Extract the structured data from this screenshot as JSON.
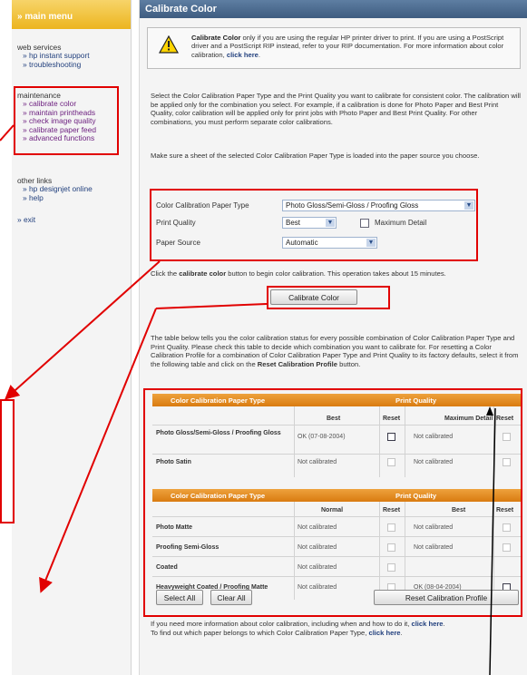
{
  "sidebar": {
    "header": "» main menu",
    "web_services": {
      "title": "web services",
      "links": [
        "» hp instant support",
        "» troubleshooting"
      ]
    },
    "maintenance": {
      "title": "maintenance",
      "links": [
        "» calibrate color",
        "» maintain printheads",
        "» check image quality",
        "» calibrate paper feed",
        "» advanced functions"
      ]
    },
    "other_links": {
      "title": "other links",
      "links": [
        "» hp designjet online",
        "» help"
      ]
    },
    "exit": "» exit"
  },
  "main": {
    "title": "Calibrate Color",
    "notice": {
      "bold_lead": "Calibrate Color",
      "text": " only if you are using the regular HP printer driver to print. If you are using a PostScript driver and a PostScript RIP instead, refer to your RIP documentation. For more information about color calibration, ",
      "link": "click here",
      "end": "."
    },
    "para1": "Select the Color Calibration Paper Type and the Print Quality you want to calibrate for consistent color. The calibration will be applied only for the combination you select. For example, if a calibration is done for Photo Paper and Best Print Quality, color calibration will be applied only for print jobs with Photo Paper and Best Print Quality. For other combinations, you must perform separate color calibrations.",
    "para2": "Make sure a sheet of the selected Color Calibration Paper Type is loaded into the paper source you choose.",
    "form": {
      "paper_type_label": "Color Calibration Paper Type",
      "paper_type_value": "Photo Gloss/Semi-Gloss / Proofing Gloss",
      "quality_label": "Print Quality",
      "quality_value": "Best",
      "max_detail_label": "Maximum Detail",
      "source_label": "Paper Source",
      "source_value": "Automatic"
    },
    "para3_a": "Click the ",
    "para3_b": "calibrate color",
    "para3_c": " button to begin color calibration. This operation takes about 15 minutes.",
    "calibrate_button": "Calibrate Color",
    "para4_a": "The table below tells you the color calibration status for every possible combination of Color Calibration Paper Type and Print Quality. Please check this table to decide which combination you want to calibrate for. For resetting a Color Calibration Profile for a combination of Color Calibration Paper Type and Print Quality to its factory defaults, select it from the following table and click on the ",
    "para4_b": "Reset Calibration Profile",
    "para4_c": " button.",
    "table1": {
      "col_paper": "Color Calibration Paper Type",
      "col_quality": "Print Quality",
      "sub": [
        "Best",
        "Reset",
        "Maximum Detail",
        "Reset"
      ],
      "rows": [
        {
          "paper": "Photo Gloss/Semi-Gloss / Proofing Gloss",
          "v1": "OK (07-08-2004)",
          "v2": "Not calibrated"
        },
        {
          "paper": "Photo Satin",
          "v1": "Not calibrated",
          "v2": "Not calibrated"
        }
      ]
    },
    "table2": {
      "col_paper": "Color Calibration Paper Type",
      "col_quality": "Print Quality",
      "sub": [
        "Normal",
        "Reset",
        "Best",
        "Reset"
      ],
      "rows": [
        {
          "paper": "Photo Matte",
          "v1": "Not calibrated",
          "v2": "Not calibrated"
        },
        {
          "paper": "Proofing Semi-Gloss",
          "v1": "Not calibrated",
          "v2": "Not calibrated"
        },
        {
          "paper": "Coated",
          "v1": "Not calibrated",
          "v2": ""
        },
        {
          "paper": "Heavyweight Coated / Proofing Matte",
          "v1": "Not calibrated",
          "v2": "OK (08-04-2004)"
        }
      ]
    },
    "select_all": "Select All",
    "clear_all": "Clear All",
    "reset_profile": "Reset Calibration Profile",
    "para5_a": "If you need more information about color calibration, including when and how to do it, ",
    "para5_link1": "click here",
    "para5_b": ".",
    "para6_a": "To find out which paper belongs to which Color Calibration Paper Type, ",
    "para6_link2": "click here",
    "para6_b": "."
  },
  "colors": {
    "accent_red": "#e10000",
    "table_header": "#e08a1c",
    "title_bar": "#4a6a8e",
    "sidebar_header": "#f0c43a"
  }
}
